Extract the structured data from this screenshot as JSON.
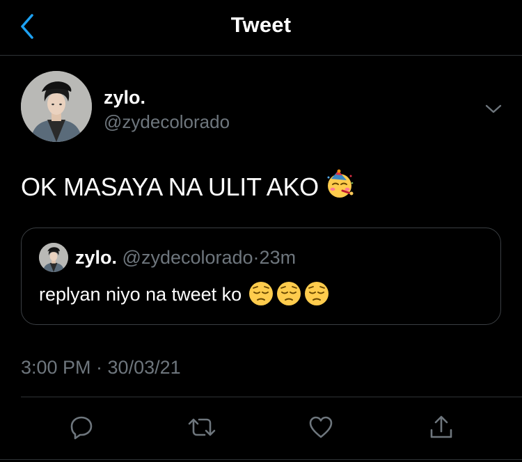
{
  "header": {
    "title": "Tweet",
    "back_icon": "chevron-left-icon",
    "accent_color": "#1da1f2"
  },
  "tweet": {
    "display_name": "zylo.",
    "handle": "@zydecolorado",
    "text": "OK MASAYA NA ULIT AKO",
    "emoji": "partying-face-emoji",
    "timestamp": "3:00 PM · 30/03/21",
    "menu_icon": "chevron-down-icon"
  },
  "quoted_tweet": {
    "display_name": "zylo.",
    "handle": "@zydecolorado",
    "separator": "·",
    "time": "23m",
    "text": "replyan niyo na tweet ko",
    "emojis": [
      "pensive-face-emoji",
      "pensive-face-emoji",
      "pensive-face-emoji"
    ]
  },
  "actions": [
    {
      "name": "reply-icon"
    },
    {
      "name": "retweet-icon"
    },
    {
      "name": "like-icon"
    },
    {
      "name": "share-icon"
    }
  ],
  "colors": {
    "background": "#000000",
    "text": "#ffffff",
    "secondary_text": "#6e767d",
    "border": "#2f3336"
  }
}
